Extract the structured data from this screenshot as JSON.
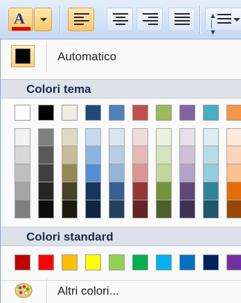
{
  "toolbar": {
    "font_color_glyph": "A",
    "font_color_accent": "#e00000",
    "buttons": [
      "font-color",
      "font-color-dropdown",
      "align-left",
      "align-center",
      "align-right",
      "justify",
      "line-spacing"
    ],
    "active_button": "align-left"
  },
  "menu": {
    "automatic_label": "Automatico",
    "automatic_color": "#000000",
    "theme_header": "Colori tema",
    "theme_base": [
      "#ffffff",
      "#000000",
      "#eeece1",
      "#1f497d",
      "#4f81bd",
      "#c0504d",
      "#9bbb59",
      "#8064a2",
      "#4bacc6",
      "#f79646"
    ],
    "theme_shades": [
      [
        "#f2f2f2",
        "#d8d8d8",
        "#bfbfbf",
        "#a5a5a5",
        "#7f7f7f"
      ],
      [
        "#7f7f7f",
        "#595959",
        "#3f3f3f",
        "#262626",
        "#0c0c0c"
      ],
      [
        "#ddd9c3",
        "#c4bd97",
        "#938953",
        "#494429",
        "#1d1b10"
      ],
      [
        "#c6d9f0",
        "#8db3e2",
        "#548dd4",
        "#17365d",
        "#0f243e"
      ],
      [
        "#dbe5f1",
        "#b8cce4",
        "#95b3d7",
        "#366092",
        "#244061"
      ],
      [
        "#f2dcdb",
        "#e5b9b7",
        "#d99694",
        "#953734",
        "#632423"
      ],
      [
        "#ebf1dd",
        "#d7e3bc",
        "#c3d69b",
        "#76923c",
        "#4f6128"
      ],
      [
        "#e5e0ec",
        "#ccc1d9",
        "#b2a2c7",
        "#5f497a",
        "#3f3151"
      ],
      [
        "#dbeef3",
        "#b7dde8",
        "#92cddc",
        "#31859b",
        "#205867"
      ],
      [
        "#fdeada",
        "#fbd5b5",
        "#fac08f",
        "#e36c09",
        "#974806"
      ]
    ],
    "standard_header": "Colori standard",
    "standard_colors": [
      "#c00000",
      "#ff0000",
      "#ffc000",
      "#ffff00",
      "#92d050",
      "#00b050",
      "#00b0f0",
      "#0070c0",
      "#002060",
      "#7030a0"
    ],
    "more_colors_label": "Altri colori..."
  }
}
